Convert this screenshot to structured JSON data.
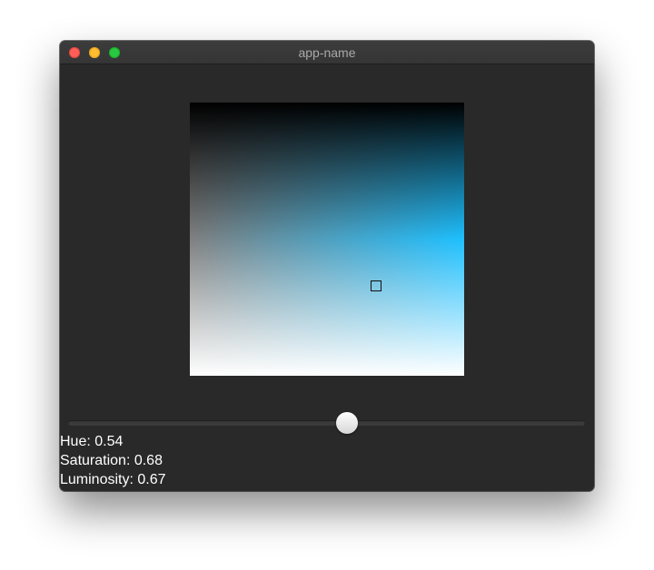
{
  "window": {
    "title": "app-name"
  },
  "color_picker": {
    "hue": 0.54,
    "saturation": 0.68,
    "luminosity": 0.67,
    "accent_color": "#1ec0ff"
  },
  "readouts": {
    "hue_text": "Hue: 0.54",
    "saturation_text": "Saturation: 0.68",
    "luminosity_text": "Luminosity: 0.67"
  },
  "icons": {
    "close": "close-traffic-light",
    "minimize": "minimize-traffic-light",
    "maximize": "maximize-traffic-light"
  }
}
